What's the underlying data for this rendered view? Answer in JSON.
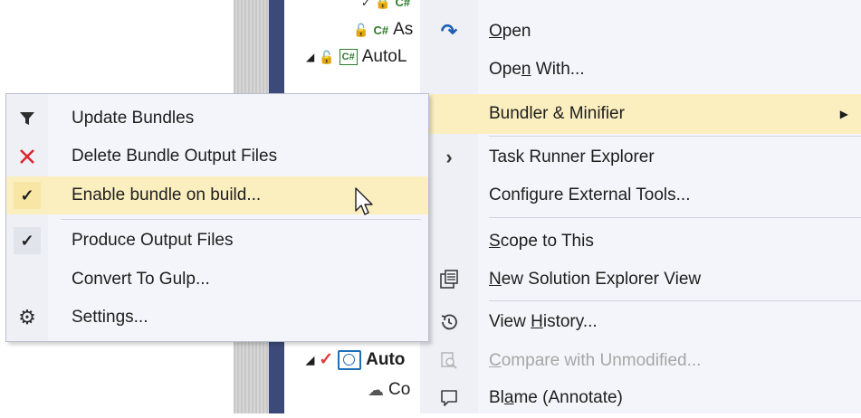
{
  "solution_explorer": {
    "rows": [
      {
        "label": ""
      },
      {
        "label": "As"
      },
      {
        "label": "AutoL"
      },
      {
        "label": "Auto"
      },
      {
        "label": "Co"
      }
    ],
    "cs_text": "C#"
  },
  "context_menu": {
    "items": [
      {
        "label_parts": [
          "",
          "O",
          "pen"
        ],
        "icon": "open-redo-arrow-icon"
      },
      {
        "label_parts": [
          "Ope",
          "n",
          " With..."
        ],
        "icon": ""
      },
      {
        "label_parts": [
          "Bundler & Minifier",
          "",
          ""
        ],
        "icon": "",
        "highlighted": true,
        "submenu": true
      },
      {
        "label_parts": [
          "Task Runner Explorer",
          "",
          ""
        ],
        "icon": "chevron-right-icon"
      },
      {
        "label_parts": [
          "Configure External Tools...",
          "",
          ""
        ],
        "icon": ""
      },
      {
        "label_parts": [
          "",
          "S",
          "cope to This"
        ],
        "icon": ""
      },
      {
        "label_parts": [
          "",
          "N",
          "ew Solution Explorer View"
        ],
        "icon": "new-explorer-view-icon"
      },
      {
        "label_parts": [
          "View ",
          "H",
          "istory..."
        ],
        "icon": "history-icon"
      },
      {
        "label_parts": [
          "",
          "C",
          "ompare with Unmodified..."
        ],
        "icon": "compare-icon",
        "disabled": true
      },
      {
        "label_parts": [
          "Bl",
          "a",
          "me (Annotate)"
        ],
        "icon": "comment-icon"
      }
    ]
  },
  "bundler_submenu": {
    "items": [
      {
        "label": "Update Bundles",
        "icon": "funnel-icon"
      },
      {
        "label": "Delete Bundle Output Files",
        "icon": "red-x-icon"
      },
      {
        "label": "Enable bundle on build...",
        "icon": "checkmark-icon",
        "highlighted": true
      },
      {
        "label": "Produce Output Files",
        "icon": "checkmark-icon"
      },
      {
        "label": "Convert To Gulp...",
        "icon": ""
      },
      {
        "label": "Settings...",
        "icon": "gear-icon"
      }
    ],
    "check_glyph": "✓"
  },
  "colors": {
    "highlight": "#fbefc0",
    "menu_bg": "#f4f5fa",
    "delete_red": "#d9262c",
    "sidebar_blue": "#3b4a78"
  }
}
